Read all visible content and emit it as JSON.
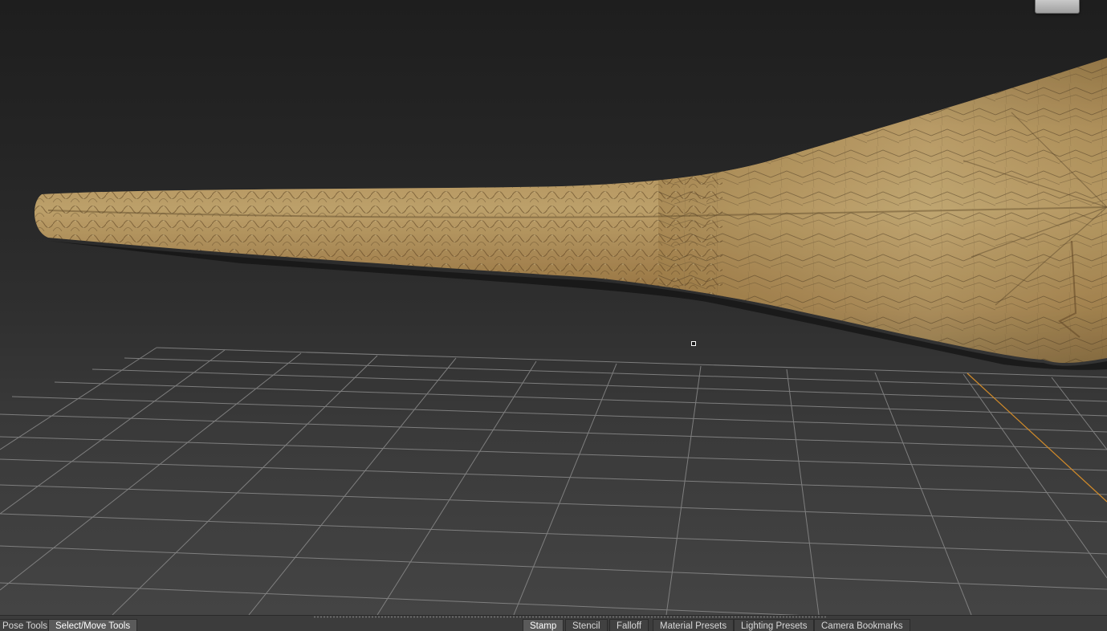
{
  "viewport": {
    "nav_cube_icon": "view-cube-icon",
    "cursor_icon": "brush-cursor-icon",
    "model": "textured-tail-mesh"
  },
  "left_tray": {
    "tabs": [
      {
        "label": "Pose Tools",
        "active": false
      },
      {
        "label": "Select/Move Tools",
        "active": true
      }
    ]
  },
  "right_tray": {
    "tabs": [
      {
        "label": "Stamp",
        "active": true
      },
      {
        "label": "Stencil",
        "active": false
      },
      {
        "label": "Falloff",
        "active": false
      },
      {
        "label": "Material Presets",
        "active": false
      },
      {
        "label": "Lighting Presets",
        "active": false
      },
      {
        "label": "Camera Bookmarks",
        "active": false
      }
    ]
  },
  "colors": {
    "background_top": "#1e1e1e",
    "background_bottom": "#444444",
    "grid": "#8a8a8a",
    "axis": "#d08a2a",
    "mesh_tan": "#b89158",
    "mesh_dark": "#5c4020"
  }
}
